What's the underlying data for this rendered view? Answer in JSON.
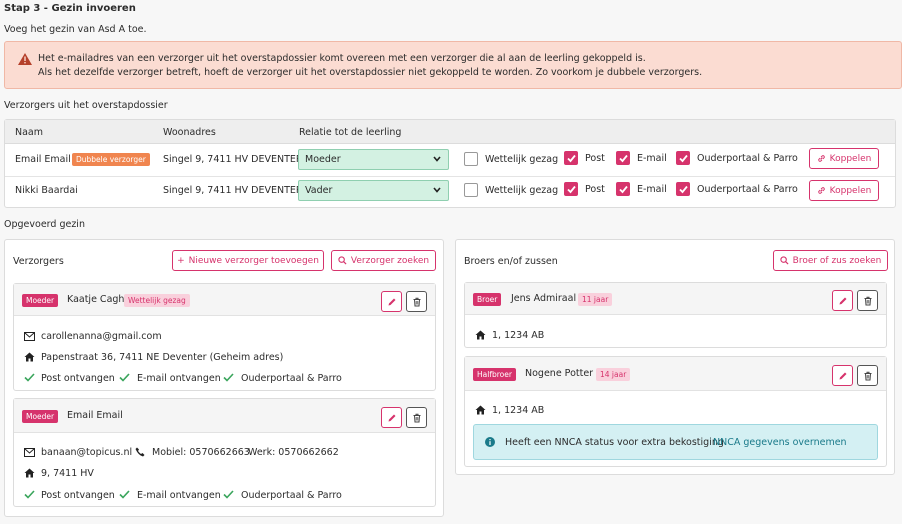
{
  "page": {
    "title": "Stap 3 - Gezin invoeren",
    "subtitle": "Voeg het gezin van Asd A toe."
  },
  "warning": {
    "line1": "Het e-mailadres van een verzorger uit het overstapdossier komt overeen met een verzorger die al aan de leerling gekoppeld is.",
    "line2": "Als het dezelfde verzorger betreft, hoeft de verzorger uit het overstapdossier niet gekoppeld te worden. Zo voorkom je dubbele verzorgers."
  },
  "dossier": {
    "label": "Verzorgers uit het overstapdossier",
    "headers": {
      "naam": "Naam",
      "woonadres": "Woonadres",
      "relatie": "Relatie tot de leerling"
    },
    "rows": [
      {
        "name": "Email Email",
        "badge": "Dubbele verzorger",
        "address": "Singel 9, 7411 HV DEVENTER",
        "relation": "Moeder",
        "wettelijk": "Wettelijk gezag",
        "post": "Post",
        "email": "E-mail",
        "ouderportaal": "Ouderportaal & Parro",
        "button": "Koppelen"
      },
      {
        "name": "Nikki Baardai",
        "badge": "",
        "address": "Singel 9, 7411 HV DEVENTER",
        "relation": "Vader",
        "wettelijk": "Wettelijk gezag",
        "post": "Post",
        "email": "E-mail",
        "ouderportaal": "Ouderportaal & Parro",
        "button": "Koppelen"
      }
    ]
  },
  "gezin": {
    "label": "Opgevoerd gezin"
  },
  "verzorgers": {
    "title": "Verzorgers",
    "add_button": "Nieuwe verzorger toevoegen",
    "search_button": "Verzorger zoeken",
    "cards": [
      {
        "role": "Moeder",
        "name": "Kaatje Cagh",
        "tag": "Wettelijk gezag",
        "email": "carollenanna@gmail.com",
        "address": "Papenstraat 36, 7411 NE Deventer (Geheim adres)",
        "checks": [
          "Post ontvangen",
          "E-mail ontvangen",
          "Ouderportaal & Parro"
        ]
      },
      {
        "role": "Moeder",
        "name": "Email Email",
        "email": "banaan@topicus.nl",
        "mobile": "Mobiel: 0570662663",
        "work": "Werk: 0570662662",
        "address": "9, 7411 HV",
        "checks": [
          "Post ontvangen",
          "E-mail ontvangen",
          "Ouderportaal & Parro"
        ]
      }
    ]
  },
  "siblings": {
    "title": "Broers en/of zussen",
    "search_button": "Broer of zus zoeken",
    "cards": [
      {
        "role": "Broer",
        "name": "Jens Admiraal",
        "age": "11 jaar",
        "address": "1, 1234 AB"
      },
      {
        "role": "Halfbroer",
        "name": "Nogene Potter",
        "age": "14 jaar",
        "address": "1, 1234 AB",
        "info": "Heeft een NNCA status voor extra bekostiging.",
        "info_link": "NNCA gegevens overnemen"
      }
    ]
  },
  "colors": {
    "accent": "#d6336c",
    "warning_bg": "#fbdcd2",
    "select_bg": "#d3f1e2",
    "info_bg": "#d4f0f3",
    "check_green": "#3aa55c"
  }
}
